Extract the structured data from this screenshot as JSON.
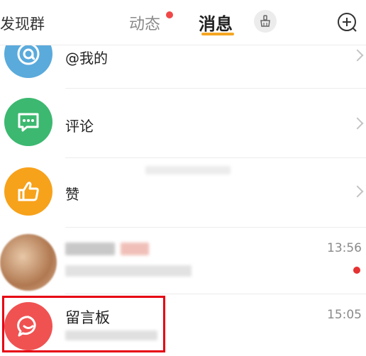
{
  "header": {
    "discover_label": "发现群",
    "tab_dynamic": "动态",
    "tab_messages": "消息",
    "tab_dynamic_has_badge": true,
    "clean_icon": "broom-icon",
    "add_icon": "circle-plus-icon",
    "accent": "#f5a623"
  },
  "rows": [
    {
      "label": "@我的",
      "icon": "at-icon",
      "color": "#5aaadc"
    },
    {
      "label": "评论",
      "icon": "comment-icon",
      "color": "#3cb870"
    },
    {
      "label": "赞",
      "icon": "thumbs-up-icon",
      "color": "#f7a21b"
    }
  ],
  "conversations": [
    {
      "title": "",
      "snippet": "",
      "time": "13:56",
      "unread": true
    },
    {
      "title": "留言板",
      "snippet": "",
      "time": "15:05",
      "icon": "chat-bubble-icon",
      "color": "#f05252"
    }
  ]
}
